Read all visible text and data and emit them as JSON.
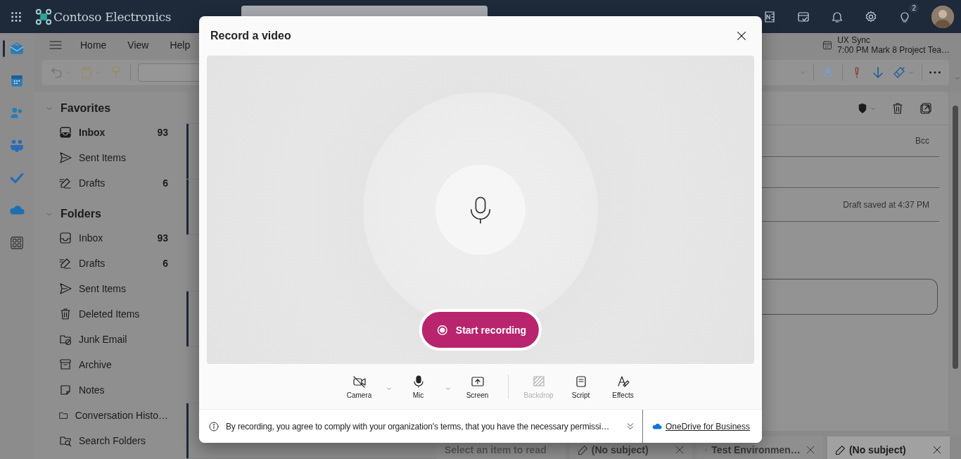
{
  "app_bar": {
    "brand": "Contoso Electronics",
    "notification_count": "2"
  },
  "rail": [
    {
      "kind": "mail",
      "selected": true
    },
    {
      "kind": "calendar",
      "selected": false
    },
    {
      "kind": "people",
      "selected": false
    },
    {
      "kind": "teams",
      "selected": false
    },
    {
      "kind": "todo",
      "selected": false
    },
    {
      "kind": "cloud",
      "selected": false
    },
    {
      "kind": "apps",
      "selected": false
    }
  ],
  "ribbon": {
    "tabs": [
      {
        "label": "Home"
      },
      {
        "label": "View"
      },
      {
        "label": "Help"
      }
    ],
    "upcoming": {
      "title": "UX Sync",
      "detail": "7:00 PM Mark 8 Project Tea…"
    }
  },
  "folders": [
    {
      "title": "Favorites",
      "expanded": true,
      "items": [
        {
          "label": "Inbox",
          "kind": "inbox",
          "count": "93",
          "selected": true
        },
        {
          "label": "Sent Items",
          "kind": "sent",
          "selected": false
        },
        {
          "label": "Drafts",
          "kind": "drafts",
          "count": "6",
          "selected": false
        }
      ]
    },
    {
      "title": "Folders",
      "expanded": true,
      "items": [
        {
          "label": "Inbox",
          "kind": "inbox",
          "count": "93",
          "selected": false
        },
        {
          "label": "Drafts",
          "kind": "drafts",
          "count": "6",
          "selected": false
        },
        {
          "label": "Sent Items",
          "kind": "sent",
          "selected": false
        },
        {
          "label": "Deleted Items",
          "kind": "deleted",
          "selected": false
        },
        {
          "label": "Junk Email",
          "kind": "junk",
          "selected": false
        },
        {
          "label": "Archive",
          "kind": "archive",
          "selected": false
        },
        {
          "label": "Notes",
          "kind": "notes",
          "selected": false
        },
        {
          "label": "Conversation Histo…",
          "kind": "folder",
          "selected": false
        },
        {
          "label": "Search Folders",
          "kind": "search-folder",
          "selected": false
        }
      ]
    }
  ],
  "compose": {
    "bcc_label": "Bcc",
    "draft_status": "Draft saved at 4:37 PM"
  },
  "bottom_tabs": {
    "placeholder_text": "Select an item to read",
    "tabs": [
      {
        "label": "(No subject)",
        "selected": false
      },
      {
        "label": "Test Environmen…",
        "selected": false
      },
      {
        "label": "(No subject)",
        "selected": true
      }
    ]
  },
  "dialog": {
    "title": "Record a video",
    "record_button": "Start recording",
    "tools": [
      {
        "label": "Camera",
        "kind": "camera",
        "has_menu": true,
        "disabled": false
      },
      {
        "label": "Mic",
        "kind": "mic",
        "has_menu": true,
        "disabled": false
      },
      {
        "label": "Screen",
        "kind": "screen",
        "has_menu": false,
        "disabled": false
      },
      {
        "label": "Backdrop",
        "kind": "backdrop",
        "has_menu": false,
        "disabled": true
      },
      {
        "label": "Script",
        "kind": "script",
        "has_menu": false,
        "disabled": false
      },
      {
        "label": "Effects",
        "kind": "effects",
        "has_menu": false,
        "disabled": false
      }
    ],
    "notice": "By recording, you agree to comply with your organization's terms, that you have the necessary permissi…",
    "storage_link": "OneDrive for Business"
  }
}
